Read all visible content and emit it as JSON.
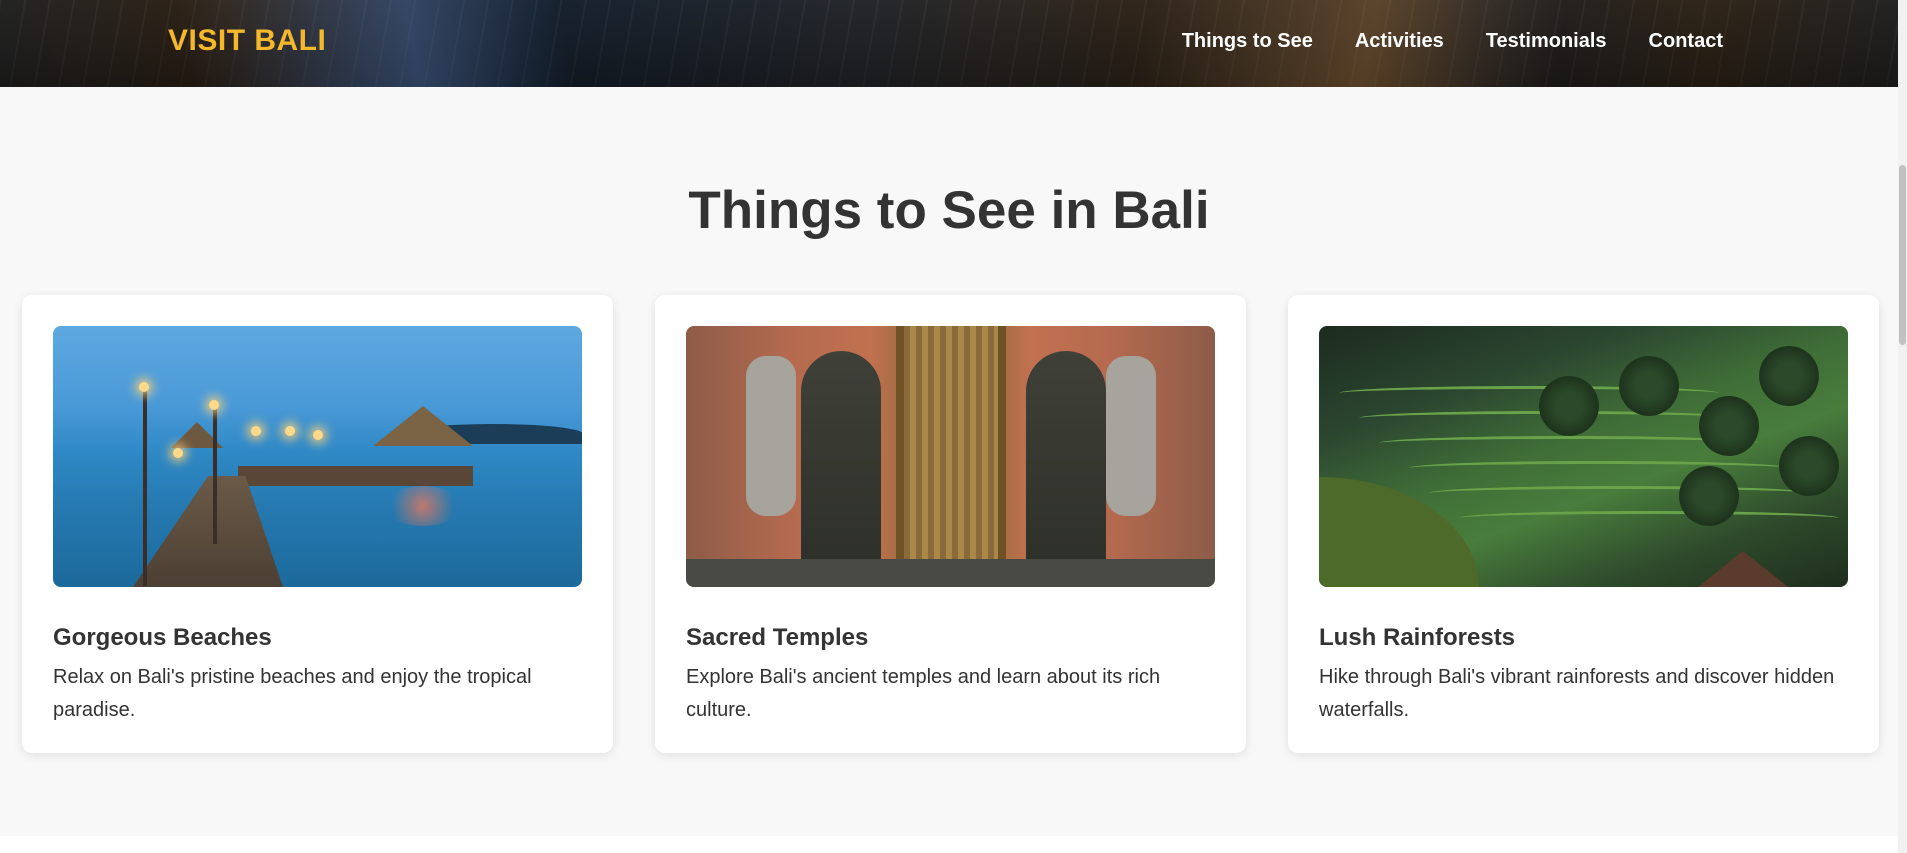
{
  "header": {
    "logo": "VISIT BALI",
    "nav": [
      "Things to See",
      "Activities",
      "Testimonials",
      "Contact"
    ]
  },
  "section": {
    "title": "Things to See in Bali",
    "cards": [
      {
        "title": "Gorgeous Beaches",
        "text": "Relax on Bali's pristine beaches and enjoy the tropical paradise.",
        "image": "beach-pier-photo"
      },
      {
        "title": "Sacred Temples",
        "text": "Explore Bali's ancient temples and learn about its rich culture.",
        "image": "temple-gate-photo"
      },
      {
        "title": "Lush Rainforests",
        "text": "Hike through Bali's vibrant rainforests and discover hidden waterfalls.",
        "image": "rice-terrace-forest-photo"
      }
    ]
  },
  "colors": {
    "logo": "#f4b82a",
    "text": "#333333",
    "page_bg": "#f8f8f8",
    "card_bg": "#ffffff"
  }
}
